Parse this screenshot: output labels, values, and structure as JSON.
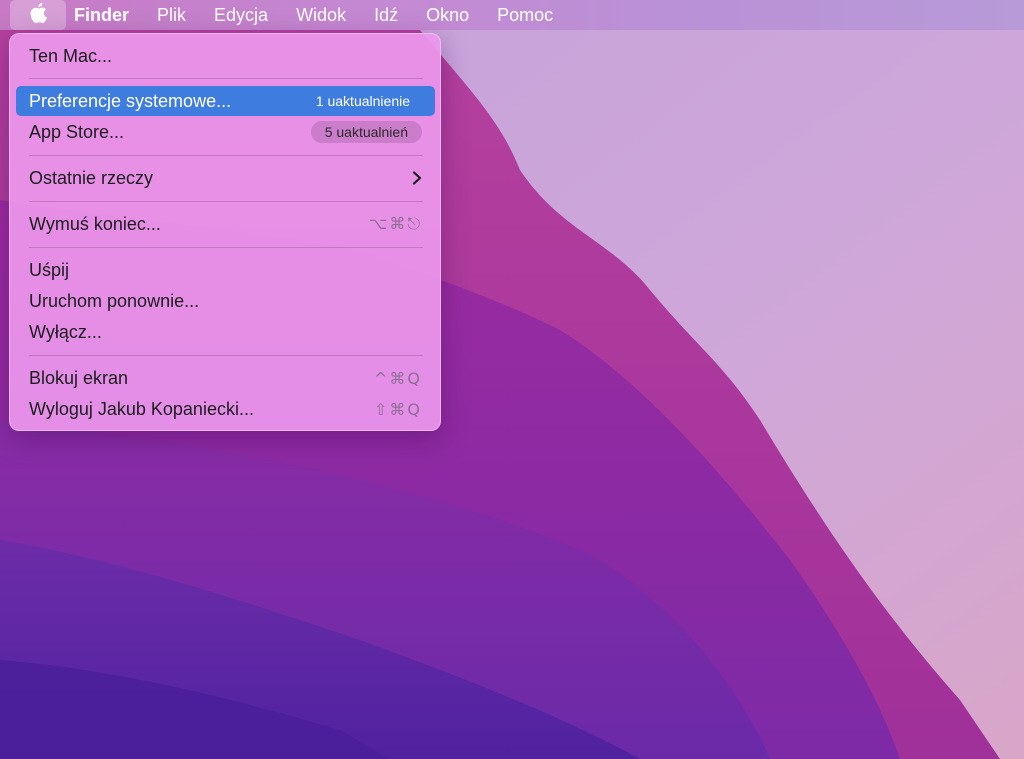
{
  "menubar": {
    "app_name": "Finder",
    "items": [
      "Plik",
      "Edycja",
      "Widok",
      "Idź",
      "Okno",
      "Pomoc"
    ]
  },
  "apple_menu": {
    "about": "Ten Mac...",
    "system_prefs": {
      "label": "Preferencje systemowe...",
      "badge": "1 uaktualnienie"
    },
    "app_store": {
      "label": "App Store...",
      "badge": "5 uaktualnień"
    },
    "recent_items": "Ostatnie rzeczy",
    "force_quit": {
      "label": "Wymuś koniec...",
      "shortcut": "⌥⌘⎋"
    },
    "sleep": "Uśpij",
    "restart": "Uruchom ponownie...",
    "shutdown": "Wyłącz...",
    "lock_screen": {
      "label": "Blokuj ekran",
      "shortcut": "^⌘Q"
    },
    "log_out": {
      "label": "Wyloguj Jakub Kopaniecki...",
      "shortcut": "⇧⌘Q"
    }
  },
  "colors": {
    "highlight": "#3e7ce0",
    "menu_bg": "#ec96ec",
    "wallpaper_light": "#c9a6dc",
    "wallpaper_dark": "#5a28a4"
  },
  "icons": {
    "apple": "apple-logo-icon",
    "submenu": "chevron-right-icon"
  }
}
